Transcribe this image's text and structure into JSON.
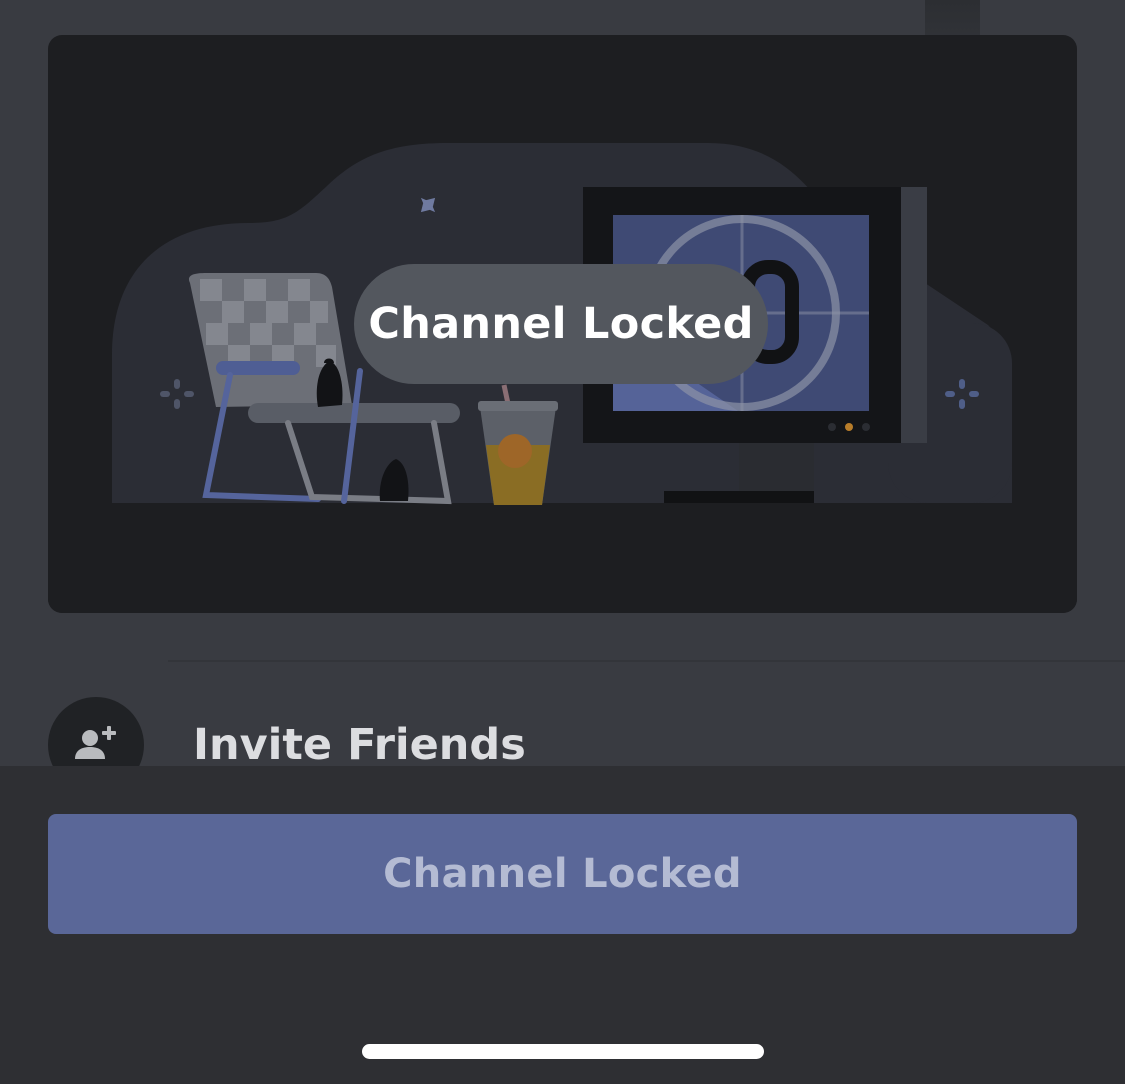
{
  "toast": {
    "text": "Channel Locked"
  },
  "invite": {
    "label": "Invite Friends",
    "icon": "add-friend-icon"
  },
  "bottom": {
    "button_label": "Channel Locked"
  },
  "colors": {
    "background": "#393b41",
    "banner": "#1d1e21",
    "toast": "#53575e",
    "button": "#5a6798",
    "button_text": "#b4bbd3",
    "bottom_panel": "#2e2f33"
  }
}
